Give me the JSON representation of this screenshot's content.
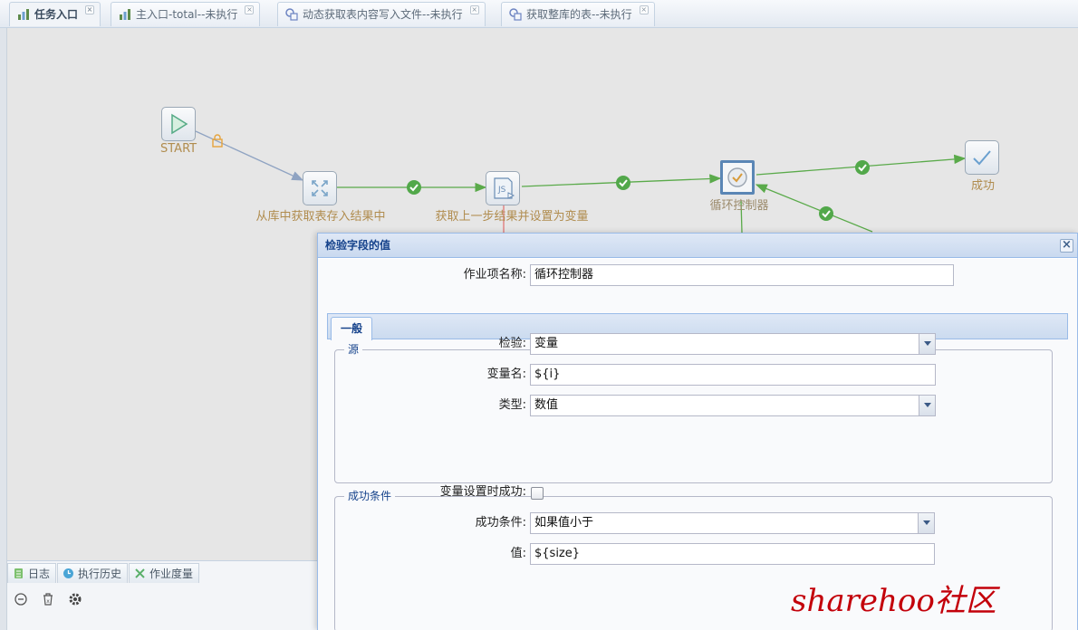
{
  "tabs": [
    {
      "label": "任务入口",
      "icon": "workflow-icon",
      "active": true
    },
    {
      "label": "主入口-total--未执行",
      "icon": "workflow-icon",
      "active": false
    },
    {
      "label": "动态获取表内容写入文件--未执行",
      "icon": "transform-icon",
      "active": false
    },
    {
      "label": "获取整库的表--未执行",
      "icon": "transform-icon",
      "active": false
    }
  ],
  "flow": {
    "nodes": {
      "start": "START",
      "table_input": "从库中获取表存入结果中",
      "script": "获取上一步结果并设置为变量",
      "loop_controller": "循环控制器",
      "success": "成功"
    }
  },
  "bottom_panel": {
    "tabs": [
      "日志",
      "执行历史",
      "作业度量"
    ]
  },
  "dialog": {
    "title": "检验字段的值",
    "job_name_label": "作业项名称:",
    "job_name_value": "循环控制器",
    "tab_general": "一般",
    "source_legend": "源",
    "check_label": "检验:",
    "check_value": "变量",
    "varname_label": "变量名:",
    "varname_value": "${i}",
    "type_label": "类型:",
    "type_value": "数值",
    "success_legend": "成功条件",
    "success_when_set_label": "变量设置时成功:",
    "success_cond_label": "成功条件:",
    "success_cond_value": "如果值小于",
    "value_label": "值:",
    "value_value": "${size}"
  },
  "watermark": "sharehoo社区",
  "colors": {
    "hop_success": "#5aaa4a",
    "hop_plain": "#8fa3c2",
    "accent": "#15428b",
    "watermark": "#c3000a"
  }
}
